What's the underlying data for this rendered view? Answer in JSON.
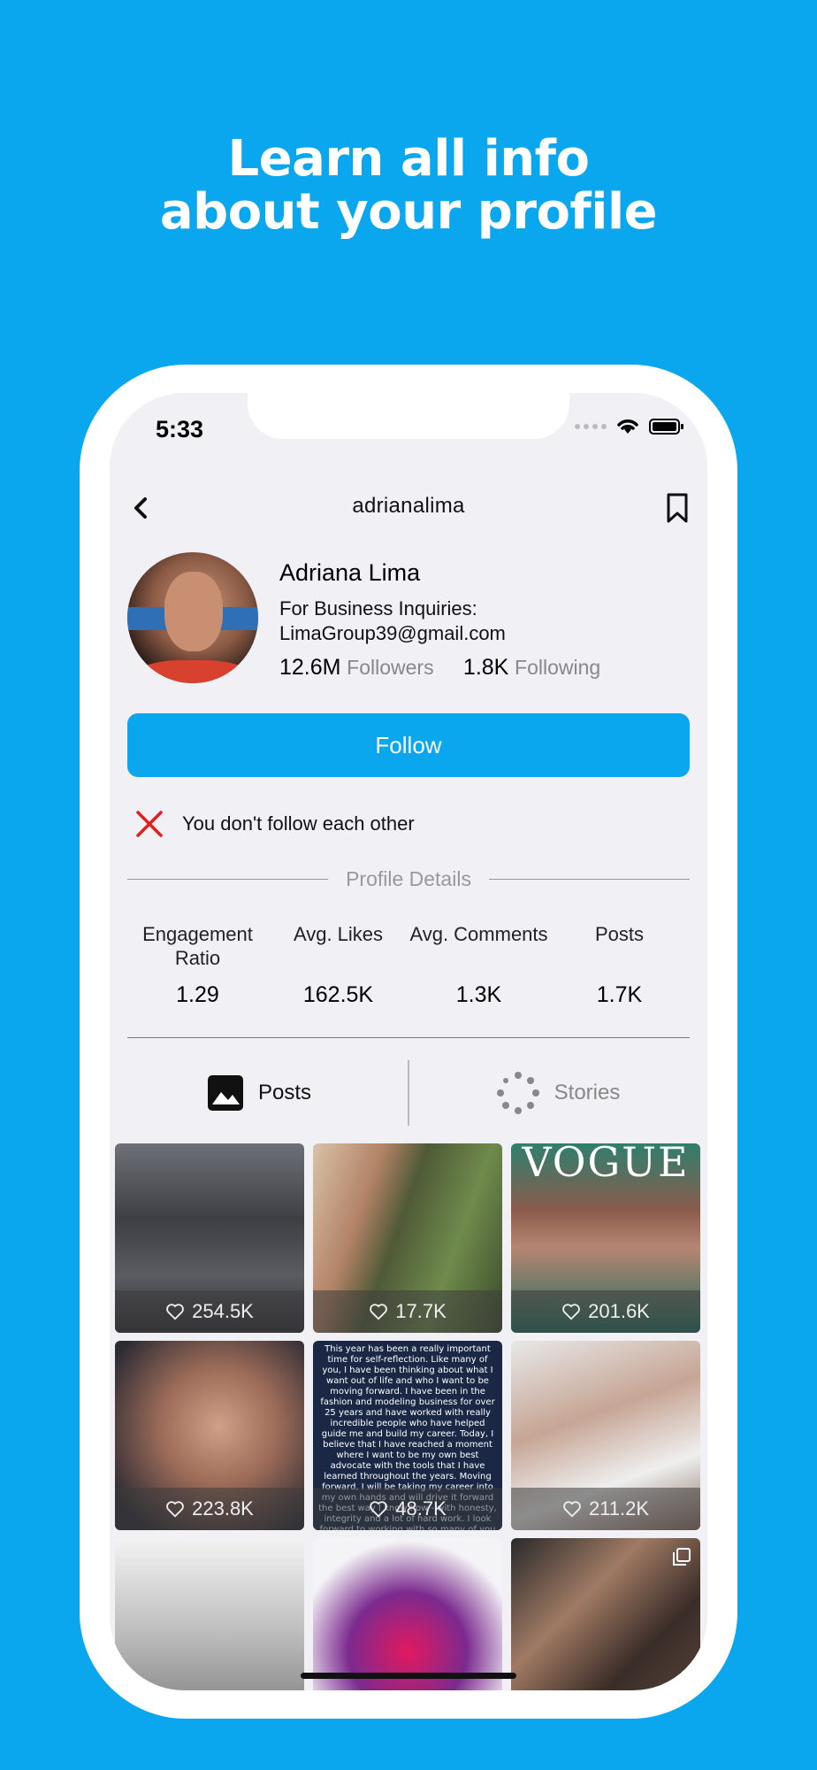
{
  "headline": {
    "line1": "Learn all info",
    "line2": "about your profile"
  },
  "status_bar": {
    "time": "5:33"
  },
  "nav": {
    "title": "adrianalima"
  },
  "profile": {
    "name": "Adriana Lima",
    "bio": "For Business Inquiries:\nLimaGroup39@gmail.com",
    "followers_count": "12.6M",
    "followers_label": "Followers",
    "following_count": "1.8K",
    "following_label": "Following"
  },
  "follow_button": {
    "label": "Follow"
  },
  "mutual_status": {
    "text": "You don't follow each other"
  },
  "details": {
    "title": "Profile Details",
    "items": [
      {
        "label": "Engagement Ratio",
        "value": "1.29"
      },
      {
        "label": "Avg. Likes",
        "value": "162.5K"
      },
      {
        "label": "Avg. Comments",
        "value": "1.3K"
      },
      {
        "label": "Posts",
        "value": "1.7K"
      }
    ]
  },
  "tabs": [
    {
      "label": "Posts",
      "active": true
    },
    {
      "label": "Stories",
      "active": false
    }
  ],
  "posts": [
    {
      "likes": "254.5K"
    },
    {
      "likes": "17.7K"
    },
    {
      "likes": "201.6K",
      "overlay": "VOGUE"
    },
    {
      "likes": "223.8K"
    },
    {
      "likes": "48.7K",
      "overlay": "This year has been a really important time for self-reflection. Like many of you, I have been thinking about what I want out of life and who I want to be moving forward. I have been in the fashion and modeling business for over 25 years and have worked with really incredible people who have helped guide me and build my career. Today, I believe that I have reached a moment where I want to be my own best advocate with the tools that I have learned throughout the years. Moving forward, I will be taking my career into my own hands and will drive it forward the best way I know how - with honesty, integrity and a lot of hard work. I look forward to working with so many of you in ways I know where to find me!"
    },
    {
      "likes": "211.2K"
    },
    {
      "likes": ""
    },
    {
      "likes": ""
    },
    {
      "likes": ""
    }
  ],
  "colors": {
    "accent": "#0aa6ee",
    "background": "#f0f0f5",
    "unfollow_x": "#e0201b"
  }
}
